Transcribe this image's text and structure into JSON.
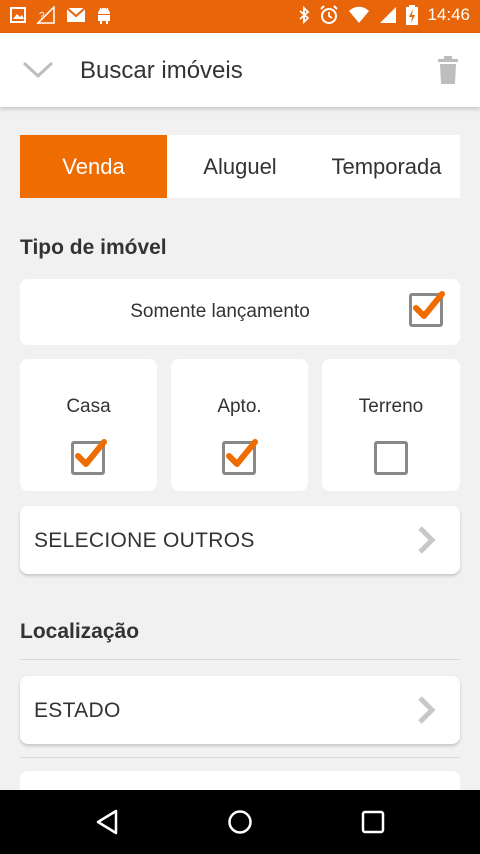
{
  "status_bar": {
    "time": "14:46",
    "left_icons": [
      "image-icon",
      "signal-off-icon",
      "gmail-icon",
      "android-icon"
    ],
    "right_icons": [
      "bluetooth-icon",
      "alarm-icon",
      "wifi-icon",
      "cell-signal-icon",
      "battery-charging-icon"
    ]
  },
  "app_bar": {
    "title": "Buscar imóveis"
  },
  "tabs": [
    {
      "label": "Venda",
      "active": true
    },
    {
      "label": "Aluguel",
      "active": false
    },
    {
      "label": "Temporada",
      "active": false
    }
  ],
  "property_type": {
    "heading": "Tipo de imóvel",
    "launch_only": {
      "label": "Somente lançamento",
      "checked": true
    },
    "types": [
      {
        "label": "Casa",
        "checked": true
      },
      {
        "label": "Apto.",
        "checked": true
      },
      {
        "label": "Terreno",
        "checked": false
      }
    ],
    "select_others": "SELECIONE OUTROS"
  },
  "location": {
    "heading": "Localização",
    "state_label": "ESTADO"
  },
  "colors": {
    "accent": "#EF6C00",
    "status_bar": "#E8650A",
    "background": "#F1F1F1"
  }
}
